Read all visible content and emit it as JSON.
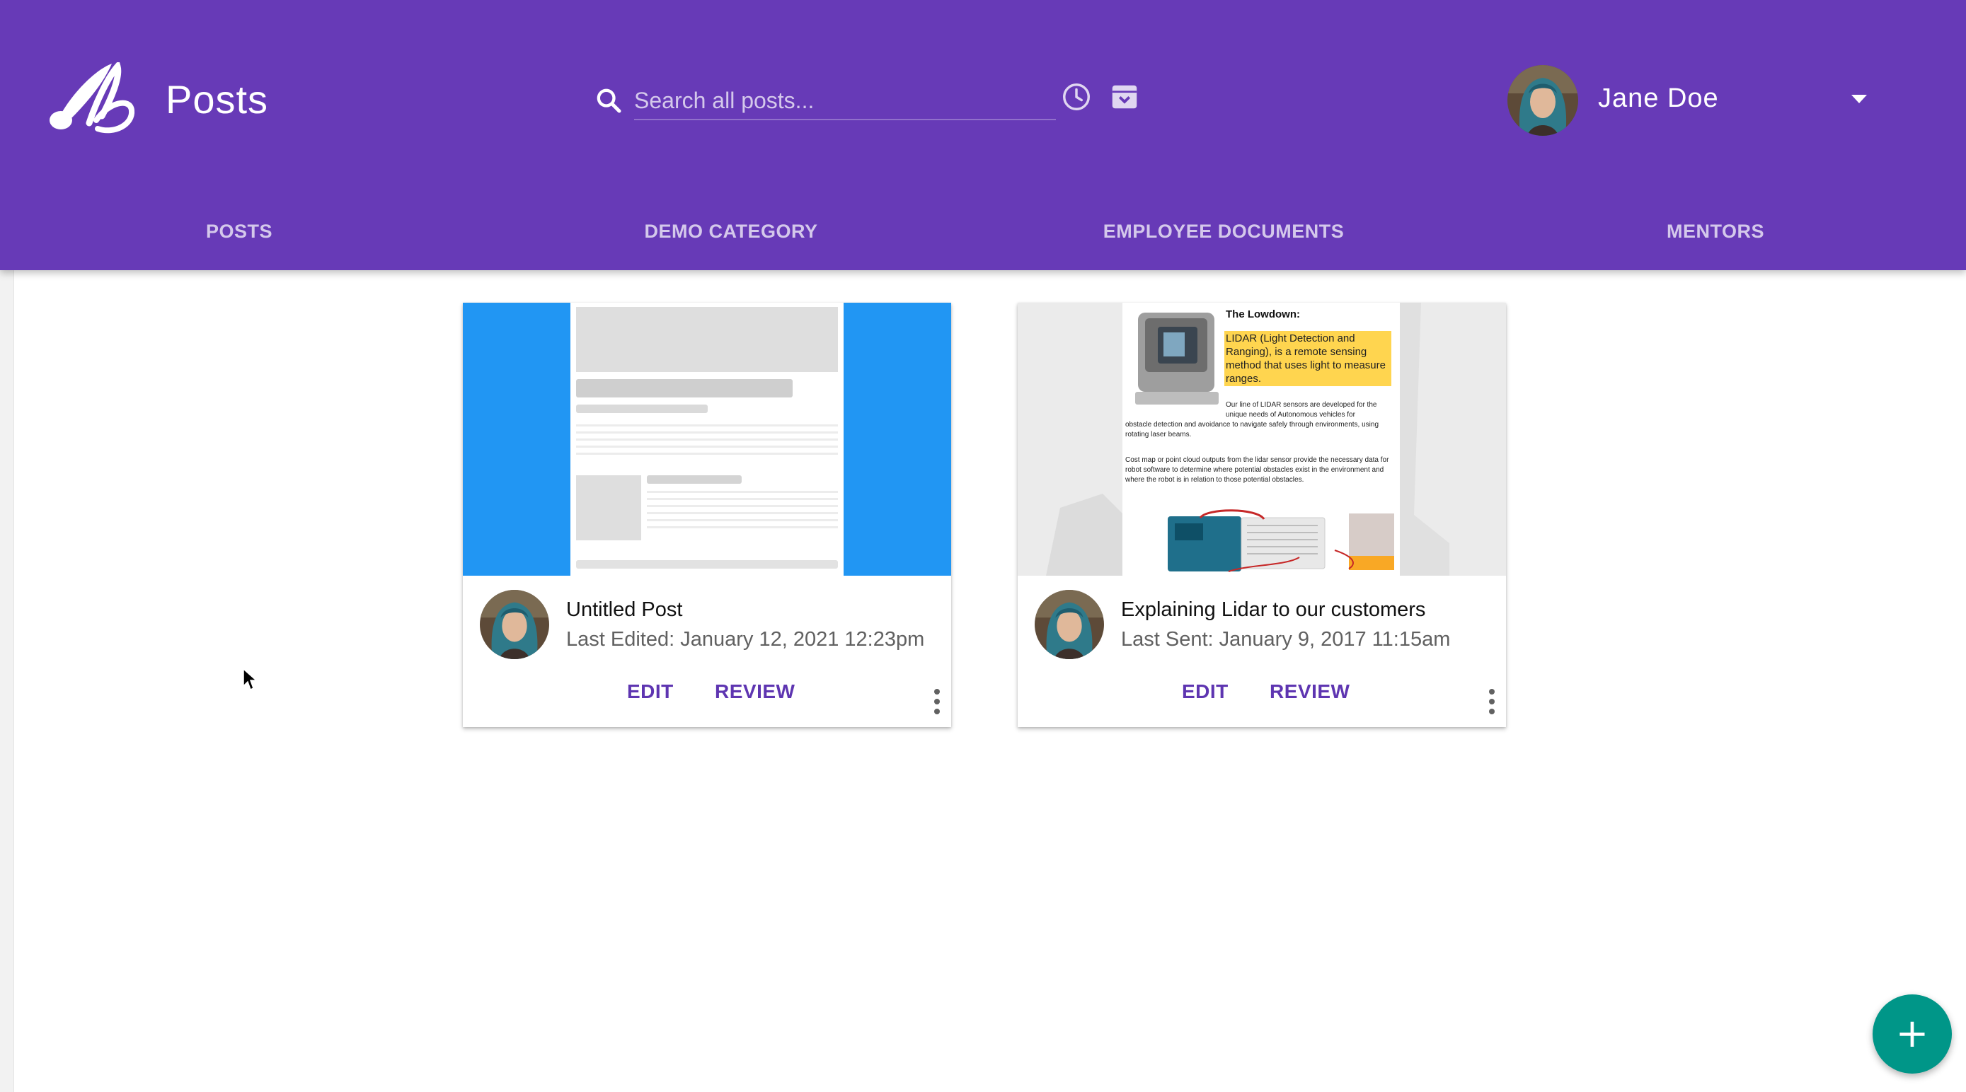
{
  "header": {
    "title": "Posts",
    "logo_icon": "brand-logo-icon",
    "background_color": "#673ab7"
  },
  "search": {
    "placeholder": "Search all posts...",
    "value": "",
    "icon": "search-icon"
  },
  "toolbar_icons": [
    "history-icon",
    "archive-icon"
  ],
  "user": {
    "name": "Jane Doe",
    "menu_icon": "caret-down-icon"
  },
  "tabs": [
    {
      "label": "POSTS"
    },
    {
      "label": "DEMO CATEGORY"
    },
    {
      "label": "EMPLOYEE DOCUMENTS"
    },
    {
      "label": "MENTORS"
    }
  ],
  "posts": [
    {
      "title": "Untitled Post",
      "subtitle": "Last Edited: January 12, 2021 12:23pm",
      "edit_label": "EDIT",
      "review_label": "REVIEW",
      "preview_color": "#2196f3"
    },
    {
      "title": "Explaining Lidar to our customers",
      "subtitle": "Last Sent: January 9, 2017 11:15am",
      "edit_label": "EDIT",
      "review_label": "REVIEW",
      "preview": {
        "heading": "The Lowdown:",
        "highlight": "LIDAR (Light Detection and Ranging), is a remote sensing method that uses light to measure ranges.",
        "para1_start": "Our line of LIDAR sensors are developed for the unique needs of Autonomous vehicles for",
        "para1_end": "obstacle detection and avoidance to navigate safely through environments, using rotating laser beams.",
        "para2": "Cost map or point cloud outputs from the lidar sensor provide the necessary data for robot software to determine where potential obstacles exist in the environment and where the robot is in relation to those potential obstacles."
      }
    }
  ],
  "fab": {
    "label": "+",
    "accent": "#009688"
  }
}
